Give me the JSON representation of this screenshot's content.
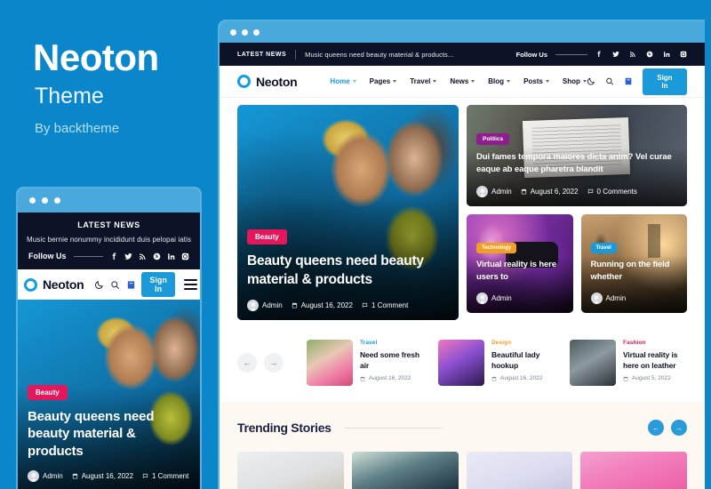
{
  "promo": {
    "title": "Neoton",
    "subtitle": "Theme",
    "byline": "By backtheme"
  },
  "mobile_preview": {
    "topbar": {
      "latest_news_label": "LATEST NEWS",
      "headline": "Music bernie nonummy incididunt duis pelopai iatis",
      "follow_label": "Follow Us",
      "socials": [
        "facebook-icon",
        "twitter-icon",
        "rss-icon",
        "pinterest-icon",
        "linkedin-icon",
        "instagram-icon"
      ]
    },
    "nav": {
      "logo": "Neoton",
      "icons": [
        "moon-icon",
        "search-icon",
        "cart-icon"
      ],
      "signin_label": "Sign In",
      "menu_icon": "hamburger-icon"
    },
    "hero": {
      "category": "Beauty",
      "title": "Beauty queens need beauty material & products",
      "author": "Admin",
      "date": "August 16, 2022",
      "comments": "1 Comment"
    }
  },
  "browser": {
    "topbar": {
      "latest_news_label": "LATEST NEWS",
      "headline": "Music queens need beauty material & products...",
      "follow_label": "Follow Us",
      "socials": [
        "facebook-icon",
        "twitter-icon",
        "rss-icon",
        "pinterest-icon",
        "linkedin-icon",
        "instagram-icon"
      ]
    },
    "nav": {
      "logo": "Neoton",
      "links": [
        {
          "label": "Home",
          "active": true
        },
        {
          "label": "Pages",
          "active": false
        },
        {
          "label": "Travel",
          "active": false
        },
        {
          "label": "News",
          "active": false
        },
        {
          "label": "Blog",
          "active": false
        },
        {
          "label": "Posts",
          "active": false
        },
        {
          "label": "Shop",
          "active": false
        }
      ],
      "icons": [
        "moon-icon",
        "search-icon",
        "cart-icon"
      ],
      "signin_label": "Sign In"
    },
    "hero": {
      "category": "Beauty",
      "title": "Beauty queens need beauty material & products",
      "author": "Admin",
      "date": "August 16, 2022",
      "comments": "1 Comment"
    },
    "feature_news": {
      "category": "Politics",
      "title": "Dui fames tempora maiores dicta anim? Vel curae eaque ab eaque pharetra blandit",
      "author": "Admin",
      "date": "August 6, 2022",
      "comments": "0 Comments"
    },
    "small_cards": [
      {
        "category": "Technology",
        "title": "Virtual reality is here users to",
        "author": "Admin"
      },
      {
        "category": "Travel",
        "title": "Running on the field whether",
        "author": "Admin"
      }
    ],
    "carousel": {
      "prev_label": "←",
      "next_label": "→"
    },
    "mini_posts": [
      {
        "category": "Travel",
        "title": "Need some fresh air",
        "date": "August 16, 2022"
      },
      {
        "category": "Design",
        "title": "Beautiful lady hookup",
        "date": "August 16, 2022"
      },
      {
        "category": "Fashion",
        "title": "Virtual reality is here on leather",
        "date": "August 5, 2022"
      }
    ],
    "trending": {
      "heading": "Trending Stories",
      "prev_label": "←",
      "next_label": "→"
    }
  },
  "colors": {
    "background_blue": "#0b86cb",
    "accent_blue": "#1a9ad8",
    "dark_navy": "#0d1227",
    "badge_pink": "#e4175c",
    "badge_purple": "#8e1d8e",
    "badge_orange": "#f0a024",
    "cream": "#fdf8f1"
  }
}
